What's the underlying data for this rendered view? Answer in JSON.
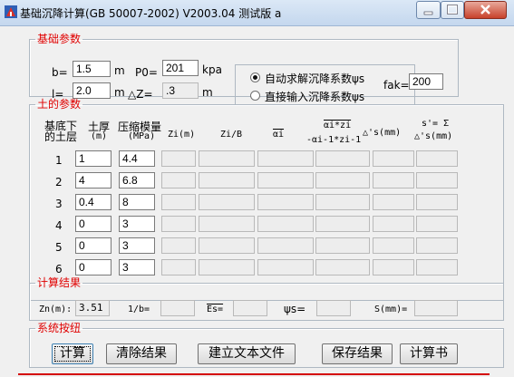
{
  "window": {
    "title": "基础沉降计算(GB 50007-2002) V2003.04 测试版 a"
  },
  "foundation": {
    "legend": "基础参数",
    "b_label": "b=",
    "b_value": "1.5",
    "b_unit": "m",
    "l_label": "l=",
    "l_value": "2.0",
    "l_unit": "m",
    "p0_label": "P0=",
    "p0_value": "201",
    "p0_unit": "kpa",
    "dz_label": "△Z=",
    "dz_value": ".3",
    "dz_unit": "m",
    "option_auto": "自动求解沉降系数ψs",
    "option_manual": "直接输入沉降系数ψs",
    "selected_option": "auto",
    "fak_label": "fak=",
    "fak_value": "200"
  },
  "soil": {
    "legend": "土的参数",
    "headers": {
      "layer": "基底下的土层",
      "thickness": "土厚",
      "thickness_unit": "(m)",
      "modulus": "压缩模量",
      "modulus_unit": "(MPa)",
      "zi": "Zi(m)",
      "zib": "Zi/B",
      "alpha": "αi",
      "alpha_diff_top": "αi*zi",
      "alpha_diff_bottom": "-αi-1*zi-1",
      "ds": "△'s(mm)",
      "sum_top": "s'= Σ",
      "sum_bottom": "△'s(mm)"
    },
    "rows": [
      {
        "num": "1",
        "thickness": "1",
        "modulus": "4.4"
      },
      {
        "num": "2",
        "thickness": "4",
        "modulus": "6.8"
      },
      {
        "num": "3",
        "thickness": "0.4",
        "modulus": "8"
      },
      {
        "num": "4",
        "thickness": "0",
        "modulus": "3"
      },
      {
        "num": "5",
        "thickness": "0",
        "modulus": "3"
      },
      {
        "num": "6",
        "thickness": "0",
        "modulus": "3"
      }
    ]
  },
  "results": {
    "legend": "计算结果",
    "zn_label": "Zn(m):",
    "zn_value": "3.51",
    "invb_label": "1/b=",
    "es_label": "Es=",
    "psi_label": "ψs=",
    "s_label": "S(mm)="
  },
  "buttons": {
    "legend": "系统按纽",
    "calc": "计算",
    "clear": "清除结果",
    "create_text": "建立文本文件",
    "save": "保存结果",
    "book": "计算书"
  },
  "colors": {
    "legend_text": "#e00000",
    "titlebar": "#c4d7ee",
    "face": "#f0f0f0"
  },
  "icons": {
    "app": "app-icon",
    "minimize": "minimize-icon",
    "maximize": "maximize-icon",
    "close": "close-icon"
  }
}
